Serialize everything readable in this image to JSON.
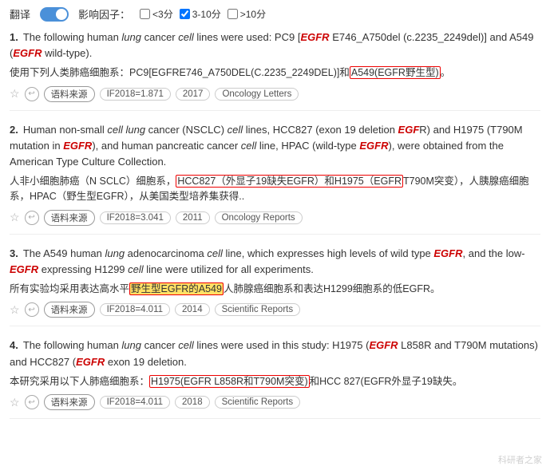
{
  "topbar": {
    "translate_label": "翻译",
    "impact_label": "影响因子：",
    "filters": [
      {
        "id": "f1",
        "label": "<3分"
      },
      {
        "id": "f2",
        "label": "3-10分"
      },
      {
        "id": "f3",
        "label": ">10分"
      }
    ]
  },
  "results": [
    {
      "number": "1.",
      "en_parts": [
        {
          "text": "The following human ",
          "style": "plain"
        },
        {
          "text": "lung",
          "style": "italic"
        },
        {
          "text": " cancer ",
          "style": "plain"
        },
        {
          "text": "cell",
          "style": "italic"
        },
        {
          "text": " lines were used: PC9 [",
          "style": "plain"
        },
        {
          "text": "EGFR",
          "style": "italic-red"
        },
        {
          "text": " E746_A750del (c.2235_2249del)] and A549 (",
          "style": "plain"
        },
        {
          "text": "EGFR",
          "style": "italic-red"
        },
        {
          "text": " wild-type).",
          "style": "plain"
        }
      ],
      "cn_parts": [
        {
          "text": "使用下列人类肺癌细胞系：PC9[EGFRE746_A750DEL(C.2235_2249DEL)]和",
          "style": "plain"
        },
        {
          "text": "A549(EGFR野生型)",
          "style": "highlight-red"
        },
        {
          "text": "。",
          "style": "plain"
        }
      ],
      "meta": {
        "if_value": "IF2018=1.871",
        "year": "2017",
        "journal": "Oncology Letters"
      }
    },
    {
      "number": "2.",
      "en_parts": [
        {
          "text": "Human non-small ",
          "style": "plain"
        },
        {
          "text": "cell",
          "style": "italic"
        },
        {
          "text": " ",
          "style": "plain"
        },
        {
          "text": "lung",
          "style": "italic"
        },
        {
          "text": " cancer (NSCLC) ",
          "style": "plain"
        },
        {
          "text": "cell",
          "style": "italic"
        },
        {
          "text": " lines, HCC827 (exon 19 deletion ",
          "style": "plain"
        },
        {
          "text": "EGF",
          "style": "italic-red"
        },
        {
          "text": "R) and H1975 (T790M mutation in ",
          "style": "plain"
        },
        {
          "text": "EGFR",
          "style": "italic-red"
        },
        {
          "text": "), and human pancreatic cancer ",
          "style": "plain"
        },
        {
          "text": "cell",
          "style": "italic"
        },
        {
          "text": " line, HPAC (wild-type ",
          "style": "plain"
        },
        {
          "text": "EGFR",
          "style": "italic-red"
        },
        {
          "text": "), were obtained from the American Type Culture Collection.",
          "style": "plain"
        }
      ],
      "cn_parts": [
        {
          "text": "人非小细胞肺癌（N SCLC）细胞系，",
          "style": "plain"
        },
        {
          "text": "HCC827（外显子19缺失EGFR）和H1975（EGFR",
          "style": "highlight-red"
        },
        {
          "text": "T790M突变），人胰腺癌细胞系，HPAC（野生型EGFR），从美国类型培养集获得..",
          "style": "plain"
        }
      ],
      "meta": {
        "if_value": "IF2018=3.041",
        "year": "2011",
        "journal": "Oncology Reports"
      }
    },
    {
      "number": "3.",
      "en_parts": [
        {
          "text": "The A549 human ",
          "style": "plain"
        },
        {
          "text": "lung",
          "style": "italic"
        },
        {
          "text": " adenocarcinoma ",
          "style": "plain"
        },
        {
          "text": "cell",
          "style": "italic"
        },
        {
          "text": " line, which expresses high levels of wild type ",
          "style": "plain"
        },
        {
          "text": "EGFR",
          "style": "italic-red"
        },
        {
          "text": ", and the low-",
          "style": "plain"
        },
        {
          "text": "EGFR",
          "style": "italic-red"
        },
        {
          "text": " expressing H1299 ",
          "style": "plain"
        },
        {
          "text": "cell",
          "style": "italic"
        },
        {
          "text": " line were utilized for all experiments.",
          "style": "plain"
        }
      ],
      "cn_parts": [
        {
          "text": "所有实验均采用表达高水平",
          "style": "plain"
        },
        {
          "text": "野生型EGFR的A549",
          "style": "highlight-yellow"
        },
        {
          "text": "人肺腺癌细胞系和表达H1299细胞系的低EGFR。",
          "style": "plain"
        }
      ],
      "meta": {
        "if_value": "IF2018=4.011",
        "year": "2014",
        "journal": "Scientific Reports"
      }
    },
    {
      "number": "4.",
      "en_parts": [
        {
          "text": "The following human ",
          "style": "plain"
        },
        {
          "text": "lung",
          "style": "italic"
        },
        {
          "text": " cancer ",
          "style": "plain"
        },
        {
          "text": "cell",
          "style": "italic"
        },
        {
          "text": " lines were used in this study: H1975 (",
          "style": "plain"
        },
        {
          "text": "EGFR",
          "style": "italic-red"
        },
        {
          "text": " L858R and T790M mutations) and HCC827 (",
          "style": "plain"
        },
        {
          "text": "EGFR",
          "style": "italic-red"
        },
        {
          "text": " exon 19 deletion.",
          "style": "plain"
        }
      ],
      "cn_parts": [
        {
          "text": "本研究采用以下人肺癌细胞系：",
          "style": "plain"
        },
        {
          "text": "H1975(EGFR L858R和T790M突变)",
          "style": "highlight-red"
        },
        {
          "text": "和HCC 827(EGFR外显子19缺失。",
          "style": "plain"
        }
      ],
      "meta": {
        "if_value": "IF2018=4.011",
        "year": "2018",
        "journal": "Scientific Reports"
      }
    }
  ],
  "watermark": "科研者之家",
  "labels": {
    "source": "语料来源"
  }
}
